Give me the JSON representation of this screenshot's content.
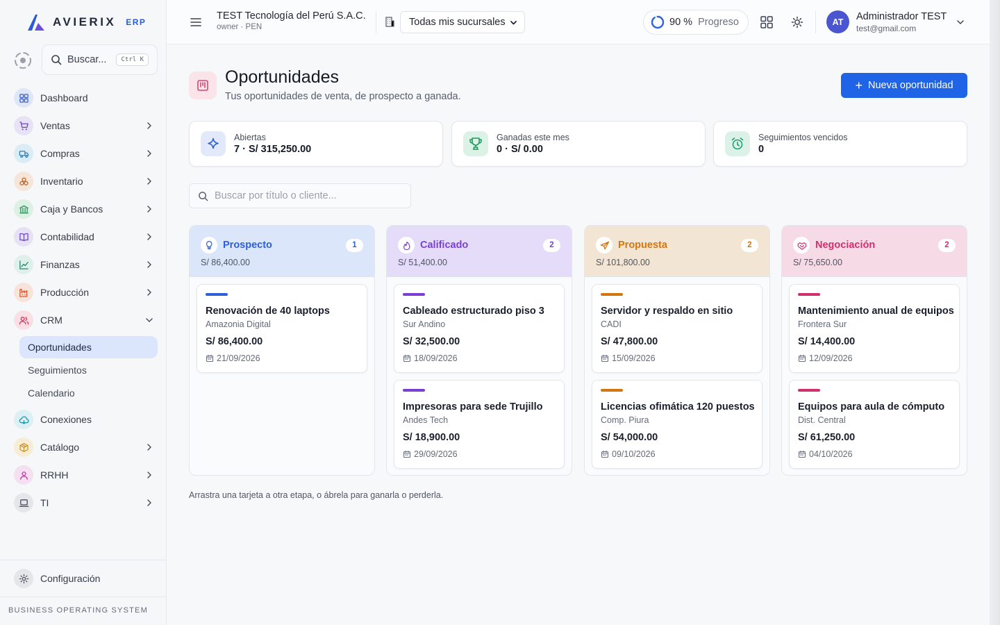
{
  "brand": {
    "name": "AVIERIX",
    "suffix": "ERP"
  },
  "sidebar": {
    "search": {
      "label": "Buscar...",
      "shortcut": "Ctrl K"
    },
    "items": [
      {
        "label": "Dashboard",
        "icon": "dashboard-icon",
        "color": "#dfe6f7",
        "stroke": "#3d63c9",
        "chevron": false
      },
      {
        "label": "Ventas",
        "icon": "cart-icon",
        "color": "#e8e2f7",
        "stroke": "#6c45c9",
        "chevron": true
      },
      {
        "label": "Compras",
        "icon": "truck-icon",
        "color": "#dcecf5",
        "stroke": "#2f7fb5",
        "chevron": true
      },
      {
        "label": "Inventario",
        "icon": "boxes-icon",
        "color": "#f6e6da",
        "stroke": "#c7631f",
        "chevron": true
      },
      {
        "label": "Caja y Bancos",
        "icon": "bank-icon",
        "color": "#dcf0e4",
        "stroke": "#24915a",
        "chevron": true
      },
      {
        "label": "Contabilidad",
        "icon": "book-icon",
        "color": "#e7e1f6",
        "stroke": "#6d4bc8",
        "chevron": true
      },
      {
        "label": "Finanzas",
        "icon": "chart-icon",
        "color": "#dff0ea",
        "stroke": "#23866a",
        "chevron": true
      },
      {
        "label": "Producción",
        "icon": "factory-icon",
        "color": "#f8e3db",
        "stroke": "#d45a2c",
        "chevron": true
      },
      {
        "label": "CRM",
        "icon": "users-icon",
        "color": "#f8e0e6",
        "stroke": "#c93a5d",
        "chevron": "open"
      }
    ],
    "crm_sub": [
      {
        "label": "Oportunidades",
        "active": true
      },
      {
        "label": "Seguimientos",
        "active": false
      },
      {
        "label": "Calendario",
        "active": false
      }
    ],
    "items_after": [
      {
        "label": "Conexiones",
        "icon": "cloud-icon",
        "color": "#dcf0f3",
        "stroke": "#1f8ea3",
        "chevron": false
      },
      {
        "label": "Catálogo",
        "icon": "package-icon",
        "color": "#f7ecd5",
        "stroke": "#c7901f",
        "chevron": true
      },
      {
        "label": "RRHH",
        "icon": "team-icon",
        "color": "#f4e0f0",
        "stroke": "#b63fa0",
        "chevron": true
      },
      {
        "label": "TI",
        "icon": "laptop-icon",
        "color": "#e4e6ea",
        "stroke": "#4a505c",
        "chevron": true
      }
    ],
    "settings": {
      "label": "Configuración",
      "icon": "gear-icon"
    },
    "footer": "BUSINESS OPERATING SYSTEM"
  },
  "topbar": {
    "company_name": "TEST Tecnología del Perú S.A.C.",
    "company_sub": "owner · PEN",
    "branch": "Todas mis sucursales",
    "progress_value": 0.9,
    "progress_pct": "90 %",
    "progress_label": "Progreso",
    "user_initials": "AT",
    "user_name": "Administrador TEST",
    "user_email": "test@gmail.com"
  },
  "page": {
    "title": "Oportunidades",
    "subtitle": "Tus oportunidades de venta, de prospecto a ganada.",
    "new_button": "Nueva oportunidad",
    "search_placeholder": "Buscar por título o cliente...",
    "hint": "Arrastra una tarjeta a otra etapa, o ábrela para ganarla o perderla."
  },
  "stats": [
    {
      "label": "Abiertas",
      "value": "7 · S/ 315,250.00",
      "icon": "sparkle-icon",
      "bg": "#e2e9fb",
      "stroke": "#2d5fd6"
    },
    {
      "label": "Ganadas este mes",
      "value": "0 · S/ 0.00",
      "icon": "trophy-icon",
      "bg": "#dcf2e6",
      "stroke": "#1f9a5c"
    },
    {
      "label": "Seguimientos vencidos",
      "value": "0",
      "icon": "alarm-icon",
      "bg": "#dcf2e8",
      "stroke": "#1fa070"
    }
  ],
  "columns": [
    {
      "title": "Prospecto",
      "count": "1",
      "total": "S/ 86,400.00",
      "icon": "bulb-icon",
      "head_bg": "#dbe6fb",
      "accent": "#2d5fd6",
      "cards": [
        {
          "title": "Renovación de 40 laptops",
          "client": "Amazonia Digital",
          "amount": "S/ 86,400.00",
          "date": "21/09/2026"
        }
      ]
    },
    {
      "title": "Calificado",
      "count": "2",
      "total": "S/ 51,400.00",
      "icon": "flame-icon",
      "head_bg": "#e4dcf8",
      "accent": "#7b3fd4",
      "cards": [
        {
          "title": "Cableado estructurado piso 3",
          "client": "Sur Andino",
          "amount": "S/ 32,500.00",
          "date": "18/09/2026"
        },
        {
          "title": "Impresoras para sede Trujillo",
          "client": "Andes Tech",
          "amount": "S/ 18,900.00",
          "date": "29/09/2026"
        }
      ]
    },
    {
      "title": "Propuesta",
      "count": "2",
      "total": "S/ 101,800.00",
      "icon": "send-icon",
      "head_bg": "#f3e5d3",
      "accent": "#d4760f",
      "cards": [
        {
          "title": "Servidor y respaldo en sitio",
          "client": "CADI",
          "amount": "S/ 47,800.00",
          "date": "15/09/2026"
        },
        {
          "title": "Licencias ofimática 120 puestos",
          "client": "Comp. Piura",
          "amount": "S/ 54,000.00",
          "date": "09/10/2026"
        }
      ]
    },
    {
      "title": "Negociación",
      "count": "2",
      "total": "S/ 75,650.00",
      "icon": "handshake-icon",
      "head_bg": "#f6dbe6",
      "accent": "#d22f6e",
      "cards": [
        {
          "title": "Mantenimiento anual de equipos",
          "client": "Frontera Sur",
          "amount": "S/ 14,400.00",
          "date": "12/09/2026"
        },
        {
          "title": "Equipos para aula de cómputo",
          "client": "Dist. Central",
          "amount": "S/ 61,250.00",
          "date": "04/10/2026"
        }
      ]
    }
  ]
}
